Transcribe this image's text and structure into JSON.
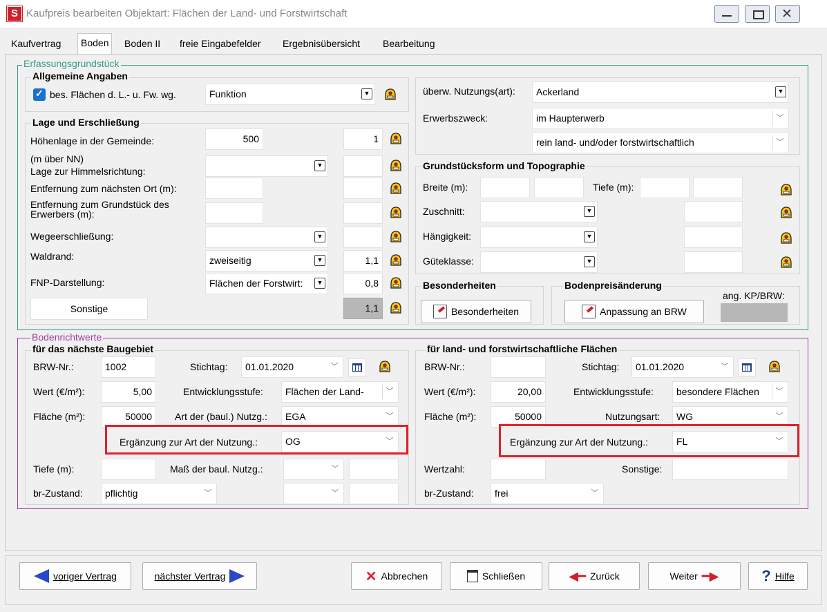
{
  "window": {
    "app_letter": "S",
    "title": "Kaufpreis bearbeiten  Objektart: Flächen der Land- und Forstwirtschaft"
  },
  "tabs": [
    {
      "label": "Kaufvertrag"
    },
    {
      "label": "Boden"
    },
    {
      "label": "Boden II"
    },
    {
      "label": "freie Eingabefelder"
    },
    {
      "label": "Ergebnisübersicht"
    },
    {
      "label": "Bearbeitung"
    }
  ],
  "erfassung": {
    "title": "Erfassungsgrundstück",
    "allgemein": {
      "title": "Allgemeine Angaben",
      "checkbox_label": "bes. Flächen d. L.- u. Fw. wg.",
      "checkbox_checked": true,
      "funktion_value": "Funktion"
    },
    "lage": {
      "title": "Lage und Erschließung",
      "hoehe_label": "Höhenlage in der Gemeinde:",
      "hoehe_value": "500",
      "hoehe_factor": "1",
      "nn_label": "(m über NN)",
      "himmel_label": "Lage zur Himmelsrichtung:",
      "ort_label": "Entfernung zum nächsten Ort (m):",
      "erwerber_label": "Entfernung zum Grundstück des Erwerbers (m):",
      "wege_label": "Wegeerschließung:",
      "wald_label": "Waldrand:",
      "wald_value": "zweiseitig",
      "wald_factor": "1,1",
      "fnp_label": "FNP-Darstellung:",
      "fnp_value": "Flächen der Forstwirt:",
      "fnp_factor": "0,8",
      "sonstige_label": "Sonstige",
      "sonstige_factor": "1,1"
    },
    "nutzung_label": "überw. Nutzungs(art):",
    "nutzung_value": "Ackerland",
    "erwerb_label": "Erwerbszweck:",
    "erwerb_value": "im Haupterwerb",
    "erwerb_value2": "rein land- und/oder forstwirtschaftlich",
    "form": {
      "title": "Grundstücksform und Topographie",
      "breite_label": "Breite (m):",
      "tiefe_label": "Tiefe (m):",
      "zuschnitt_label": "Zuschnitt:",
      "haengig_label": "Hängigkeit:",
      "guete_label": "Güteklasse:"
    },
    "besonder_title": "Besonderheiten",
    "besonder_button": "Besonderheiten",
    "bodenpreis_title": "Bodenpreisänderung",
    "anpassung_button": "Anpassung an BRW",
    "angkp_label": "ang. KP/BRW:"
  },
  "brw": {
    "title": "Bodenrichtwerte",
    "left": {
      "title": "für das nächste Baugebiet",
      "brwnr_label": "BRW-Nr.:",
      "brwnr_value": "1002",
      "stichtag_label": "Stichtag:",
      "stichtag_value": "01.01.2020",
      "wert_label": "Wert (€/m²):",
      "wert_value": "5,00",
      "entw_label": "Entwicklungsstufe:",
      "entw_value": "Flächen der Land-",
      "flaeche_label": "Fläche (m²):",
      "flaeche_value": "50000",
      "art_label": "Art der (baul.) Nutzg.:",
      "art_value": "EGA",
      "erg_label": "Ergänzung zur Art der Nutzung.:",
      "erg_value": "OG",
      "tiefe_label": "Tiefe (m):",
      "mass_label": "Maß der baul. Nutzg.:",
      "zustand_label": "br-Zustand:",
      "zustand_value": "pflichtig"
    },
    "right": {
      "title": "für land- und forstwirtschaftliche Flächen",
      "brwnr_label": "BRW-Nr.:",
      "brwnr_value": "",
      "stichtag_label": "Stichtag:",
      "stichtag_value": "01.01.2020",
      "wert_label": "Wert (€/m²):",
      "wert_value": "20,00",
      "entw_label": "Entwicklungsstufe:",
      "entw_value": "besondere Flächen",
      "flaeche_label": "Fläche (m²):",
      "flaeche_value": "50000",
      "nutzart_label": "Nutzungsart:",
      "nutzart_value": "WG",
      "erg_label": "Ergänzung zur Art der Nutzung.:",
      "erg_value": "FL",
      "wertzahl_label": "Wertzahl:",
      "sonstige_label": "Sonstige:",
      "zustand_label": "br-Zustand:",
      "zustand_value": "frei"
    }
  },
  "buttons": {
    "prev": "voriger Vertrag",
    "next": "nächster Vertrag",
    "cancel": "Abbrechen",
    "close": "Schließen",
    "back": "Zurück",
    "forward": "Weiter",
    "help": "Hilfe"
  },
  "colors": {
    "group_teal": "#3a9a8c",
    "group_purple": "#a040a0",
    "highlight_red": "#e0202a",
    "checkbox_blue": "#1a73c9",
    "app_icon_red": "#d0202a"
  }
}
